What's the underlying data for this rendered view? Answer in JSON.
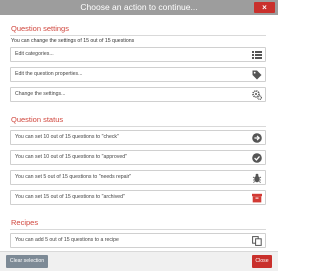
{
  "window": {
    "title": "Choose an action to continue...",
    "close_glyph": "×"
  },
  "settings": {
    "title": "Question settings",
    "hint": "You can change the settings of 15 out of 15 questions",
    "items": [
      {
        "label": "Edit categories...",
        "icon": "list-icon"
      },
      {
        "label": "Edit the question properties...",
        "icon": "tag-icon"
      },
      {
        "label": "Change the settings...",
        "icon": "gears-icon"
      }
    ]
  },
  "status": {
    "title": "Question status",
    "items": [
      {
        "label": "You can set 10 out of 15 questions to \"check\"",
        "icon": "arrow-circle-icon"
      },
      {
        "label": "You can set 10 out of 15 questions to \"approved\"",
        "icon": "check-circle-icon"
      },
      {
        "label": "You can set 5 out of 15 questions to \"needs repair\"",
        "icon": "bug-icon"
      },
      {
        "label": "You can set 15 out of 15 questions to \"archived\"",
        "icon": "archive-icon"
      }
    ]
  },
  "recipes": {
    "title": "Recipes",
    "items": [
      {
        "label": "You can add 5 out of 15 questions to a recipe",
        "icon": "copy-icon"
      }
    ]
  },
  "footer": {
    "clear_label": "Clear selection",
    "close_label": "Close"
  },
  "colors": {
    "titlebar": "#9d9d9d",
    "accent_red": "#c9302c",
    "section_title": "#d0463d"
  }
}
